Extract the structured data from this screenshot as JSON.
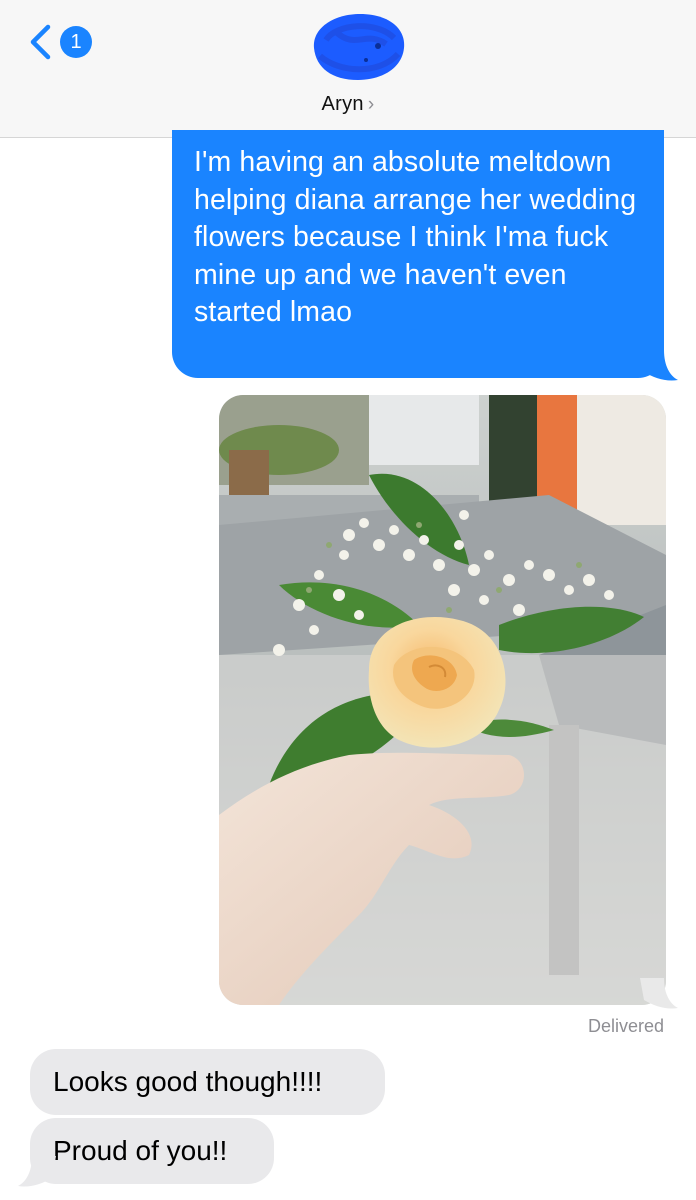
{
  "header": {
    "back_badge": "1",
    "contact_name": "Aryn",
    "contact_chevron": "›"
  },
  "messages": {
    "sent_text": "I'm having an absolute meltdown helping diana arrange her wedding flowers because I think I'ma fuck mine up and we haven't even started lmao",
    "status": "Delivered",
    "received": [
      {
        "text": "Looks good though!!!!"
      },
      {
        "text": "Proud of you!!"
      }
    ]
  },
  "colors": {
    "sent_bubble": "#1a84ff",
    "received_bubble": "#e9e9eb",
    "header_bg": "#f7f7f7",
    "avatar_scribble": "#1c5cff"
  },
  "icons": {
    "back": "chevron-left-icon",
    "contact": "chevron-right-icon"
  }
}
